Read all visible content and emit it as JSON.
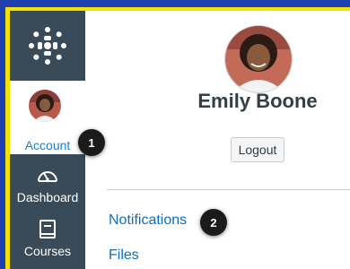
{
  "nav": {
    "account_label": "Account",
    "items": [
      {
        "label": "Dashboard",
        "icon": "speedometer-icon"
      },
      {
        "label": "Courses",
        "icon": "book-icon"
      }
    ]
  },
  "tray": {
    "user_name": "Emily Boone",
    "logout_label": "Logout",
    "links": [
      {
        "label": "Notifications"
      },
      {
        "label": "Files"
      }
    ]
  },
  "callouts": [
    "1",
    "2"
  ],
  "colors": {
    "nav_bg": "#394b58",
    "link": "#0e6ebd",
    "frame_highlight": "#f2e300",
    "outer_bg": "#1f3fae"
  }
}
